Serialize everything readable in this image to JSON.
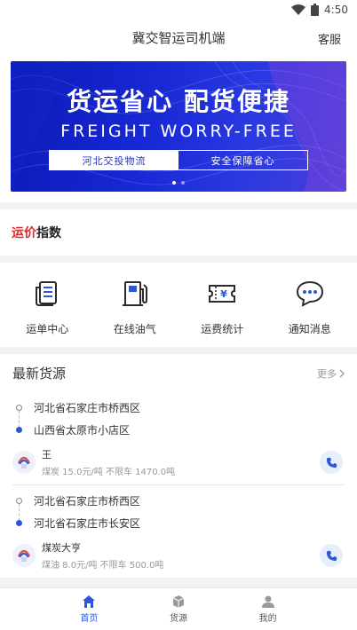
{
  "status": {
    "time": "4:50"
  },
  "header": {
    "title": "冀交智运司机端",
    "service": "客服"
  },
  "banner": {
    "headline": "货运省心 配货便捷",
    "subline": "FREIGHT WORRY-FREE",
    "pill_left": "河北交投物流",
    "pill_right": "安全保障省心",
    "slide_count": 2,
    "active_slide": 1
  },
  "index": {
    "title_red": "运价",
    "title_black": "指数"
  },
  "grid": [
    {
      "label": "运单中心",
      "icon": "waybill-icon"
    },
    {
      "label": "在线油气",
      "icon": "fuel-pump-icon"
    },
    {
      "label": "运费统计",
      "icon": "fee-ticket-icon"
    },
    {
      "label": "通知消息",
      "icon": "message-icon"
    }
  ],
  "cargo": {
    "title": "最新货源",
    "more": "更多",
    "items": [
      {
        "from": "河北省石家庄市桥西区",
        "to": "山西省太原市小店区",
        "owner": "王",
        "meta": "煤炭 15.0元/吨 不限车 1470.0吨"
      },
      {
        "from": "河北省石家庄市桥西区",
        "to": "河北省石家庄市长安区",
        "owner": "煤炭大亨",
        "meta": "煤油 8.0元/吨 不限车 500.0吨"
      }
    ]
  },
  "nav": [
    {
      "label": "首页",
      "icon": "home-icon",
      "active": true
    },
    {
      "label": "货源",
      "icon": "cargo-box-icon",
      "active": false
    },
    {
      "label": "我的",
      "icon": "user-icon",
      "active": false
    }
  ],
  "colors": {
    "primary": "#2d56d8",
    "accent_red": "#e5252b",
    "banner": "#1a2ad6"
  }
}
